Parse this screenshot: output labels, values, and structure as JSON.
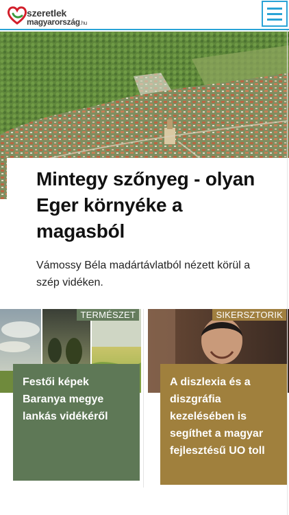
{
  "header": {
    "logo_line1": "szeretlek",
    "logo_line2": "magyarország",
    "logo_tld": ".hu",
    "menu_icon": "hamburger-menu-icon",
    "accent_color": "#29a3d6"
  },
  "hero": {
    "title": "Mintegy szőnyeg - olyan Eger környéke a magasból",
    "lead": "Vámossy Béla madártávlatból nézett körül a szép vidéken."
  },
  "cards": [
    {
      "category": "TERMÉSZET",
      "title": "Festői képek Baranya megye lankás vidékéről",
      "color": "#5e7856"
    },
    {
      "category": "SIKERSZTORIK",
      "title": "A diszlexia és a diszgráfia kezelésében is segíthet a magyar fejlesztésű UO toll",
      "color": "#a0803d"
    }
  ]
}
